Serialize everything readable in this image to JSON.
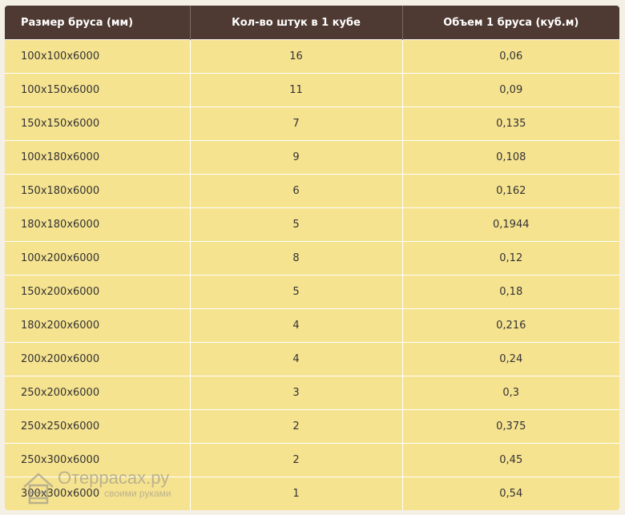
{
  "table": {
    "headers": [
      "Размер бруса (мм)",
      "Кол-во штук в 1 кубе",
      "Объем 1 бруса (куб.м)"
    ],
    "rows": [
      [
        "100x100x6000",
        "16",
        "0,06"
      ],
      [
        "100x150x6000",
        "11",
        "0,09"
      ],
      [
        "150x150x6000",
        "7",
        "0,135"
      ],
      [
        "100x180x6000",
        "9",
        "0,108"
      ],
      [
        "150x180x6000",
        "6",
        "0,162"
      ],
      [
        "180x180x6000",
        "5",
        "0,1944"
      ],
      [
        "100x200x6000",
        "8",
        "0,12"
      ],
      [
        "150x200x6000",
        "5",
        "0,18"
      ],
      [
        "180x200x6000",
        "4",
        "0,216"
      ],
      [
        "200x200x6000",
        "4",
        "0,24"
      ],
      [
        "250x200x6000",
        "3",
        "0,3"
      ],
      [
        "250x250x6000",
        "2",
        "0,375"
      ],
      [
        "250x300x6000",
        "2",
        "0,45"
      ],
      [
        "300x300x6000",
        "1",
        "0,54"
      ]
    ]
  },
  "watermark": {
    "site": "Отеррасах.ру",
    "tagline": "своими руками"
  },
  "colors": {
    "header_bg": "#4e3a32",
    "row_bg": "#f6e390",
    "text": "#333333"
  }
}
